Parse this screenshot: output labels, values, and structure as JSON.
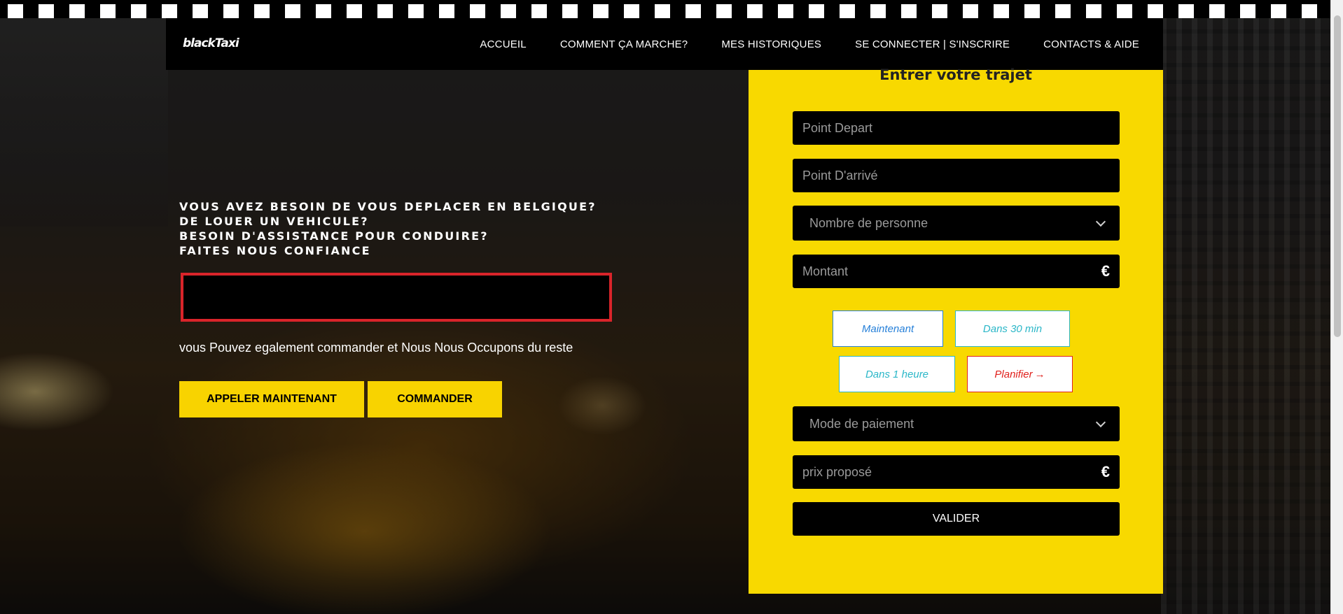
{
  "header": {
    "logo_text": "blackTaxi",
    "nav": [
      {
        "label": "ACCUEIL"
      },
      {
        "label": "COMMENT ÇA MARCHE?"
      },
      {
        "label": "MES HISTORIQUES"
      },
      {
        "label": "SE CONNECTER | S'INSCRIRE"
      },
      {
        "label": "CONTACTS & AIDE"
      }
    ]
  },
  "hero": {
    "lines": [
      "VOUS AVEZ BESOIN DE VOUS DEPLACER EN BELGIQUE?",
      "DE LOUER UN VEHICULE?",
      "BESOIN D'ASSISTANCE POUR CONDUIRE?",
      "FAITES NOUS CONFIANCE"
    ],
    "subtitle": "vous Pouvez egalement commander et Nous Nous Occupons du reste",
    "call_button": "APPELER MAINTENANT",
    "order_button": "COMMANDER"
  },
  "form": {
    "title": "Entrer votre trajet",
    "departure_placeholder": "Point Depart",
    "arrival_placeholder": "Point D'arrivé",
    "people_select": "Nombre de personne",
    "amount_placeholder": "Montant",
    "currency_symbol": "€",
    "time_options": {
      "now": "Maintenant",
      "in30": "Dans 30 min",
      "in1h": "Dans 1 heure",
      "plan": "Planifier"
    },
    "plan_arrow": "→",
    "payment_select": "Mode de paiement",
    "proposed_price_placeholder": "prix proposé",
    "submit_label": "VALIDER"
  },
  "colors": {
    "brand_yellow": "#f8d900",
    "accent_red": "#d9242a",
    "time_cyan": "#2bb7c8",
    "time_blue": "#2680d9",
    "plan_red": "#e0201c"
  }
}
